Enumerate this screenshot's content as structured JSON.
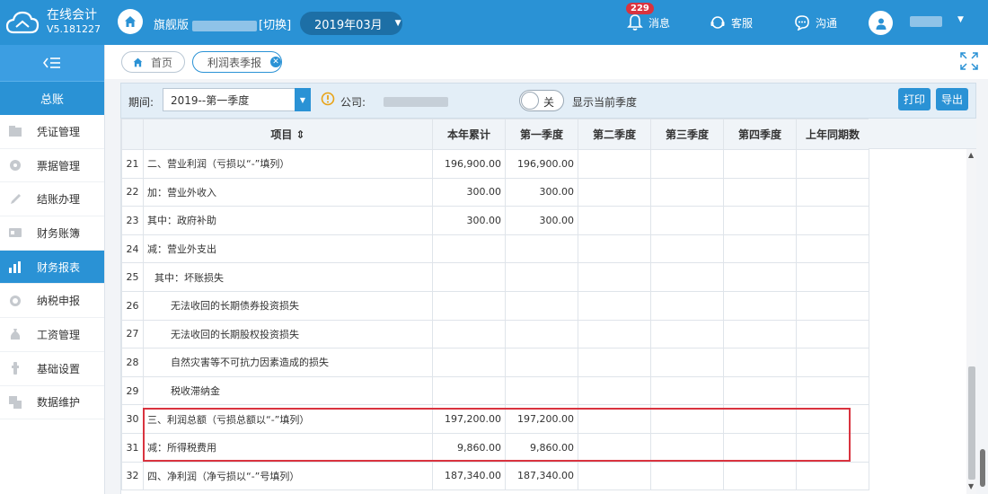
{
  "app": {
    "title": "在线会计",
    "version": "V5.181227",
    "edition": "旗舰版",
    "company_suffix": "[切换]"
  },
  "header": {
    "period": "2019年03月",
    "notifications": {
      "label": "消息",
      "count": "229"
    },
    "service_label": "客服",
    "chat_label": "沟通"
  },
  "sidebar": {
    "section_title": "总账",
    "items": [
      {
        "label": "凭证管理",
        "icon": "voucher-icon"
      },
      {
        "label": "票据管理",
        "icon": "receipt-icon"
      },
      {
        "label": "结账办理",
        "icon": "pen-icon"
      },
      {
        "label": "财务账簿",
        "icon": "ledger-icon"
      },
      {
        "label": "财务报表",
        "icon": "report-icon",
        "active": true
      },
      {
        "label": "纳税申报",
        "icon": "tax-icon"
      },
      {
        "label": "工资管理",
        "icon": "salary-icon"
      },
      {
        "label": "基础设置",
        "icon": "settings-icon"
      },
      {
        "label": "数据维护",
        "icon": "data-icon"
      }
    ]
  },
  "tabs": {
    "home": "首页",
    "active": "利润表季报"
  },
  "toolbar": {
    "period_label": "期间:",
    "period_value": "2019--第一季度",
    "company_label": "公司:",
    "toggle_label": "关",
    "toggle_desc": "显示当前季度",
    "print": "打印",
    "export": "导出"
  },
  "table": {
    "headers": [
      "项目 ⇕",
      "本年累计",
      "第一季度",
      "第二季度",
      "第三季度",
      "第四季度",
      "上年同期数"
    ],
    "rows": [
      {
        "no": "21",
        "item": "二、营业利润（亏损以“-”填列）",
        "indent": 0,
        "ytd": "196,900.00",
        "q1": "196,900.00"
      },
      {
        "no": "22",
        "item": "加：营业外收入",
        "indent": 0,
        "ytd": "300.00",
        "q1": "300.00"
      },
      {
        "no": "23",
        "item": "其中：政府补助",
        "indent": 0,
        "ytd": "300.00",
        "q1": "300.00"
      },
      {
        "no": "24",
        "item": "减：营业外支出",
        "indent": 0,
        "ytd": "",
        "q1": ""
      },
      {
        "no": "25",
        "item": "其中：坏账损失",
        "indent": 1,
        "ytd": "",
        "q1": ""
      },
      {
        "no": "26",
        "item": "无法收回的长期债券投资损失",
        "indent": 2,
        "ytd": "",
        "q1": ""
      },
      {
        "no": "27",
        "item": "无法收回的长期股权投资损失",
        "indent": 2,
        "ytd": "",
        "q1": ""
      },
      {
        "no": "28",
        "item": "自然灾害等不可抗力因素造成的损失",
        "indent": 2,
        "ytd": "",
        "q1": ""
      },
      {
        "no": "29",
        "item": "税收滞纳金",
        "indent": 2,
        "ytd": "",
        "q1": ""
      },
      {
        "no": "30",
        "item": "三、利润总额（亏损总额以“-”填列）",
        "indent": 0,
        "ytd": "197,200.00",
        "q1": "197,200.00"
      },
      {
        "no": "31",
        "item": "减：所得税费用",
        "indent": 0,
        "ytd": "9,860.00",
        "q1": "9,860.00"
      },
      {
        "no": "32",
        "item": "四、净利润（净亏损以“-”号填列）",
        "indent": 0,
        "ytd": "187,340.00",
        "q1": "187,340.00"
      }
    ]
  },
  "colors": {
    "brand": "#2a92d5",
    "highlight": "#d9333f"
  }
}
